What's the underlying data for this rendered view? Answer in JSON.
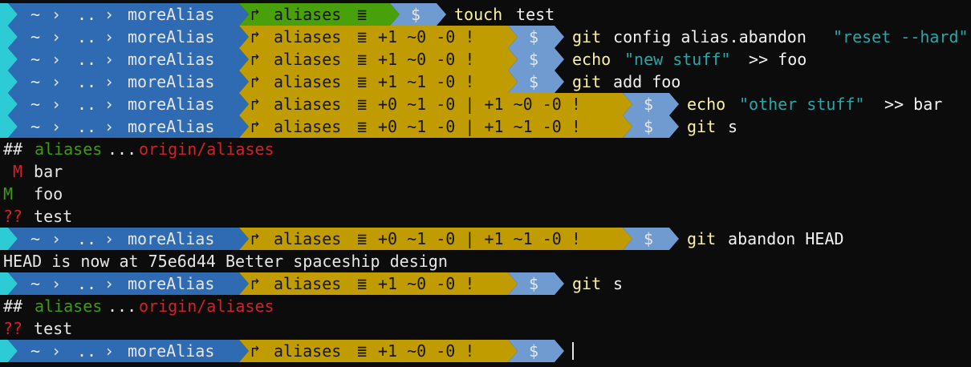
{
  "colors": {
    "cyan": "#2dcbd6",
    "path_blue": "#2e6bb2",
    "git_clean": "#48a10a",
    "git_dirty": "#c19c00",
    "dollar_blue": "#6f9bd1",
    "cmd_yellow": "#f9f1a5",
    "cmd_white": "#f2f2f2",
    "string_cyan": "#2aa6a6",
    "red": "#d0222a",
    "green": "#3e9a14",
    "text": "#e6e6e6",
    "dark_text": "#161616"
  },
  "prompt": {
    "home": "~",
    "up": "..",
    "dir": "moreAlias",
    "branch_icon": "↱",
    "branch": "aliases",
    "sync_icon": "≣",
    "dollar": "$",
    "chevron": "›"
  },
  "lines": [
    {
      "kind": "prompt",
      "status": "",
      "git": "clean",
      "cmd": [
        {
          "t": "touch",
          "c": "cmd_yellow"
        },
        {
          "t": " test",
          "c": "cmd_white"
        }
      ]
    },
    {
      "kind": "prompt",
      "status": "+1 ~0 -0 !",
      "git": "dirty",
      "cmd": [
        {
          "t": "git",
          "c": "cmd_yellow"
        },
        {
          "t": " config alias.abandon ",
          "c": "cmd_white"
        },
        {
          "t": "\"reset --hard\"",
          "c": "string_cyan"
        }
      ]
    },
    {
      "kind": "prompt",
      "status": "+1 ~0 -0 !",
      "git": "dirty",
      "cmd": [
        {
          "t": "echo",
          "c": "cmd_yellow"
        },
        {
          "t": " ",
          "c": "cmd_white"
        },
        {
          "t": "\"new stuff\"",
          "c": "string_cyan"
        },
        {
          "t": " >> foo",
          "c": "cmd_white"
        }
      ]
    },
    {
      "kind": "prompt",
      "status": "+1 ~1 -0 !",
      "git": "dirty",
      "cmd": [
        {
          "t": "git",
          "c": "cmd_yellow"
        },
        {
          "t": " add foo",
          "c": "cmd_white"
        }
      ]
    },
    {
      "kind": "prompt",
      "status": "+0 ~1 -0 | +1 ~0 -0 !",
      "git": "dirty",
      "cmd": [
        {
          "t": "echo",
          "c": "cmd_yellow"
        },
        {
          "t": " ",
          "c": "cmd_white"
        },
        {
          "t": "\"other stuff\"",
          "c": "string_cyan"
        },
        {
          "t": " >> bar",
          "c": "cmd_white"
        }
      ]
    },
    {
      "kind": "prompt",
      "status": "+0 ~1 -0 | +1 ~1 -0 !",
      "git": "dirty",
      "cmd": [
        {
          "t": "git",
          "c": "cmd_yellow"
        },
        {
          "t": " s",
          "c": "cmd_white"
        }
      ]
    },
    {
      "kind": "out",
      "parts": [
        {
          "t": "## ",
          "c": "text"
        },
        {
          "t": "aliases",
          "c": "green"
        },
        {
          "t": "...",
          "c": "text"
        },
        {
          "t": "origin/aliases",
          "c": "red"
        }
      ]
    },
    {
      "kind": "out",
      "parts": [
        {
          "t": " M",
          "c": "red"
        },
        {
          "t": " bar",
          "c": "text"
        }
      ]
    },
    {
      "kind": "out",
      "parts": [
        {
          "t": "M ",
          "c": "green"
        },
        {
          "t": " foo",
          "c": "text"
        }
      ]
    },
    {
      "kind": "out",
      "parts": [
        {
          "t": "??",
          "c": "red"
        },
        {
          "t": " test",
          "c": "text"
        }
      ]
    },
    {
      "kind": "prompt",
      "status": "+0 ~1 -0 | +1 ~1 -0 !",
      "git": "dirty",
      "cmd": [
        {
          "t": "git",
          "c": "cmd_yellow"
        },
        {
          "t": " abandon HEAD",
          "c": "cmd_white"
        }
      ]
    },
    {
      "kind": "out",
      "parts": [
        {
          "t": "HEAD is now at 75e6d44 Better spaceship design",
          "c": "text"
        }
      ]
    },
    {
      "kind": "prompt",
      "status": "+1 ~0 -0 !",
      "git": "dirty",
      "cmd": [
        {
          "t": "git",
          "c": "cmd_yellow"
        },
        {
          "t": " s",
          "c": "cmd_white"
        }
      ]
    },
    {
      "kind": "out",
      "parts": [
        {
          "t": "## ",
          "c": "text"
        },
        {
          "t": "aliases",
          "c": "green"
        },
        {
          "t": "...",
          "c": "text"
        },
        {
          "t": "origin/aliases",
          "c": "red"
        }
      ]
    },
    {
      "kind": "out",
      "parts": [
        {
          "t": "??",
          "c": "red"
        },
        {
          "t": " test",
          "c": "text"
        }
      ]
    },
    {
      "kind": "prompt",
      "status": "+1 ~0 -0 !",
      "git": "dirty",
      "cmd": [],
      "cursor": true
    }
  ]
}
